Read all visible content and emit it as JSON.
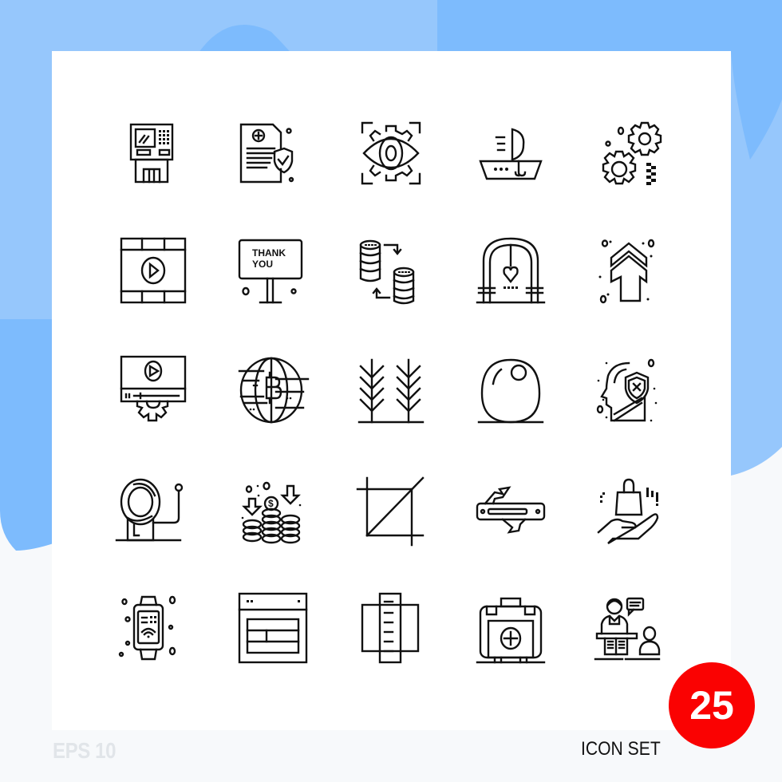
{
  "colors": {
    "background": "#f7f9fb",
    "blob_light": "#96c7fc",
    "blob_mid": "#7dbbfd",
    "card": "#ffffff",
    "stroke": "#111111",
    "badge": "#fa0202",
    "eps_text": "#e1e5e9"
  },
  "footer": {
    "format_label": "EPS 10",
    "set_label": "ICON SET",
    "count_badge": "25"
  },
  "icons": [
    {
      "name": "atm-machine-icon"
    },
    {
      "name": "insurance-document-icon"
    },
    {
      "name": "eye-gear-vision-icon"
    },
    {
      "name": "boat-ship-icon"
    },
    {
      "name": "gears-settings-icon"
    },
    {
      "name": "video-film-icon",
      "text": ""
    },
    {
      "name": "thank-you-board-icon",
      "text_line1": "THANK",
      "text_line2": "YOU"
    },
    {
      "name": "database-transfer-icon"
    },
    {
      "name": "wedding-arch-icon"
    },
    {
      "name": "arrow-up-chevrons-icon"
    },
    {
      "name": "video-settings-icon"
    },
    {
      "name": "bitcoin-globe-icon"
    },
    {
      "name": "wheat-plants-icon"
    },
    {
      "name": "egg-icon"
    },
    {
      "name": "mind-shield-protection-icon"
    },
    {
      "name": "bell-alarm-icon"
    },
    {
      "name": "dollar-coins-icon",
      "symbol": "$"
    },
    {
      "name": "crop-tool-icon"
    },
    {
      "name": "swiss-knife-icon"
    },
    {
      "name": "hand-shopping-bag-icon"
    },
    {
      "name": "smartwatch-wifi-icon"
    },
    {
      "name": "web-layout-icon"
    },
    {
      "name": "ruler-scale-icon"
    },
    {
      "name": "first-aid-kit-icon"
    },
    {
      "name": "teacher-presentation-icon"
    }
  ]
}
